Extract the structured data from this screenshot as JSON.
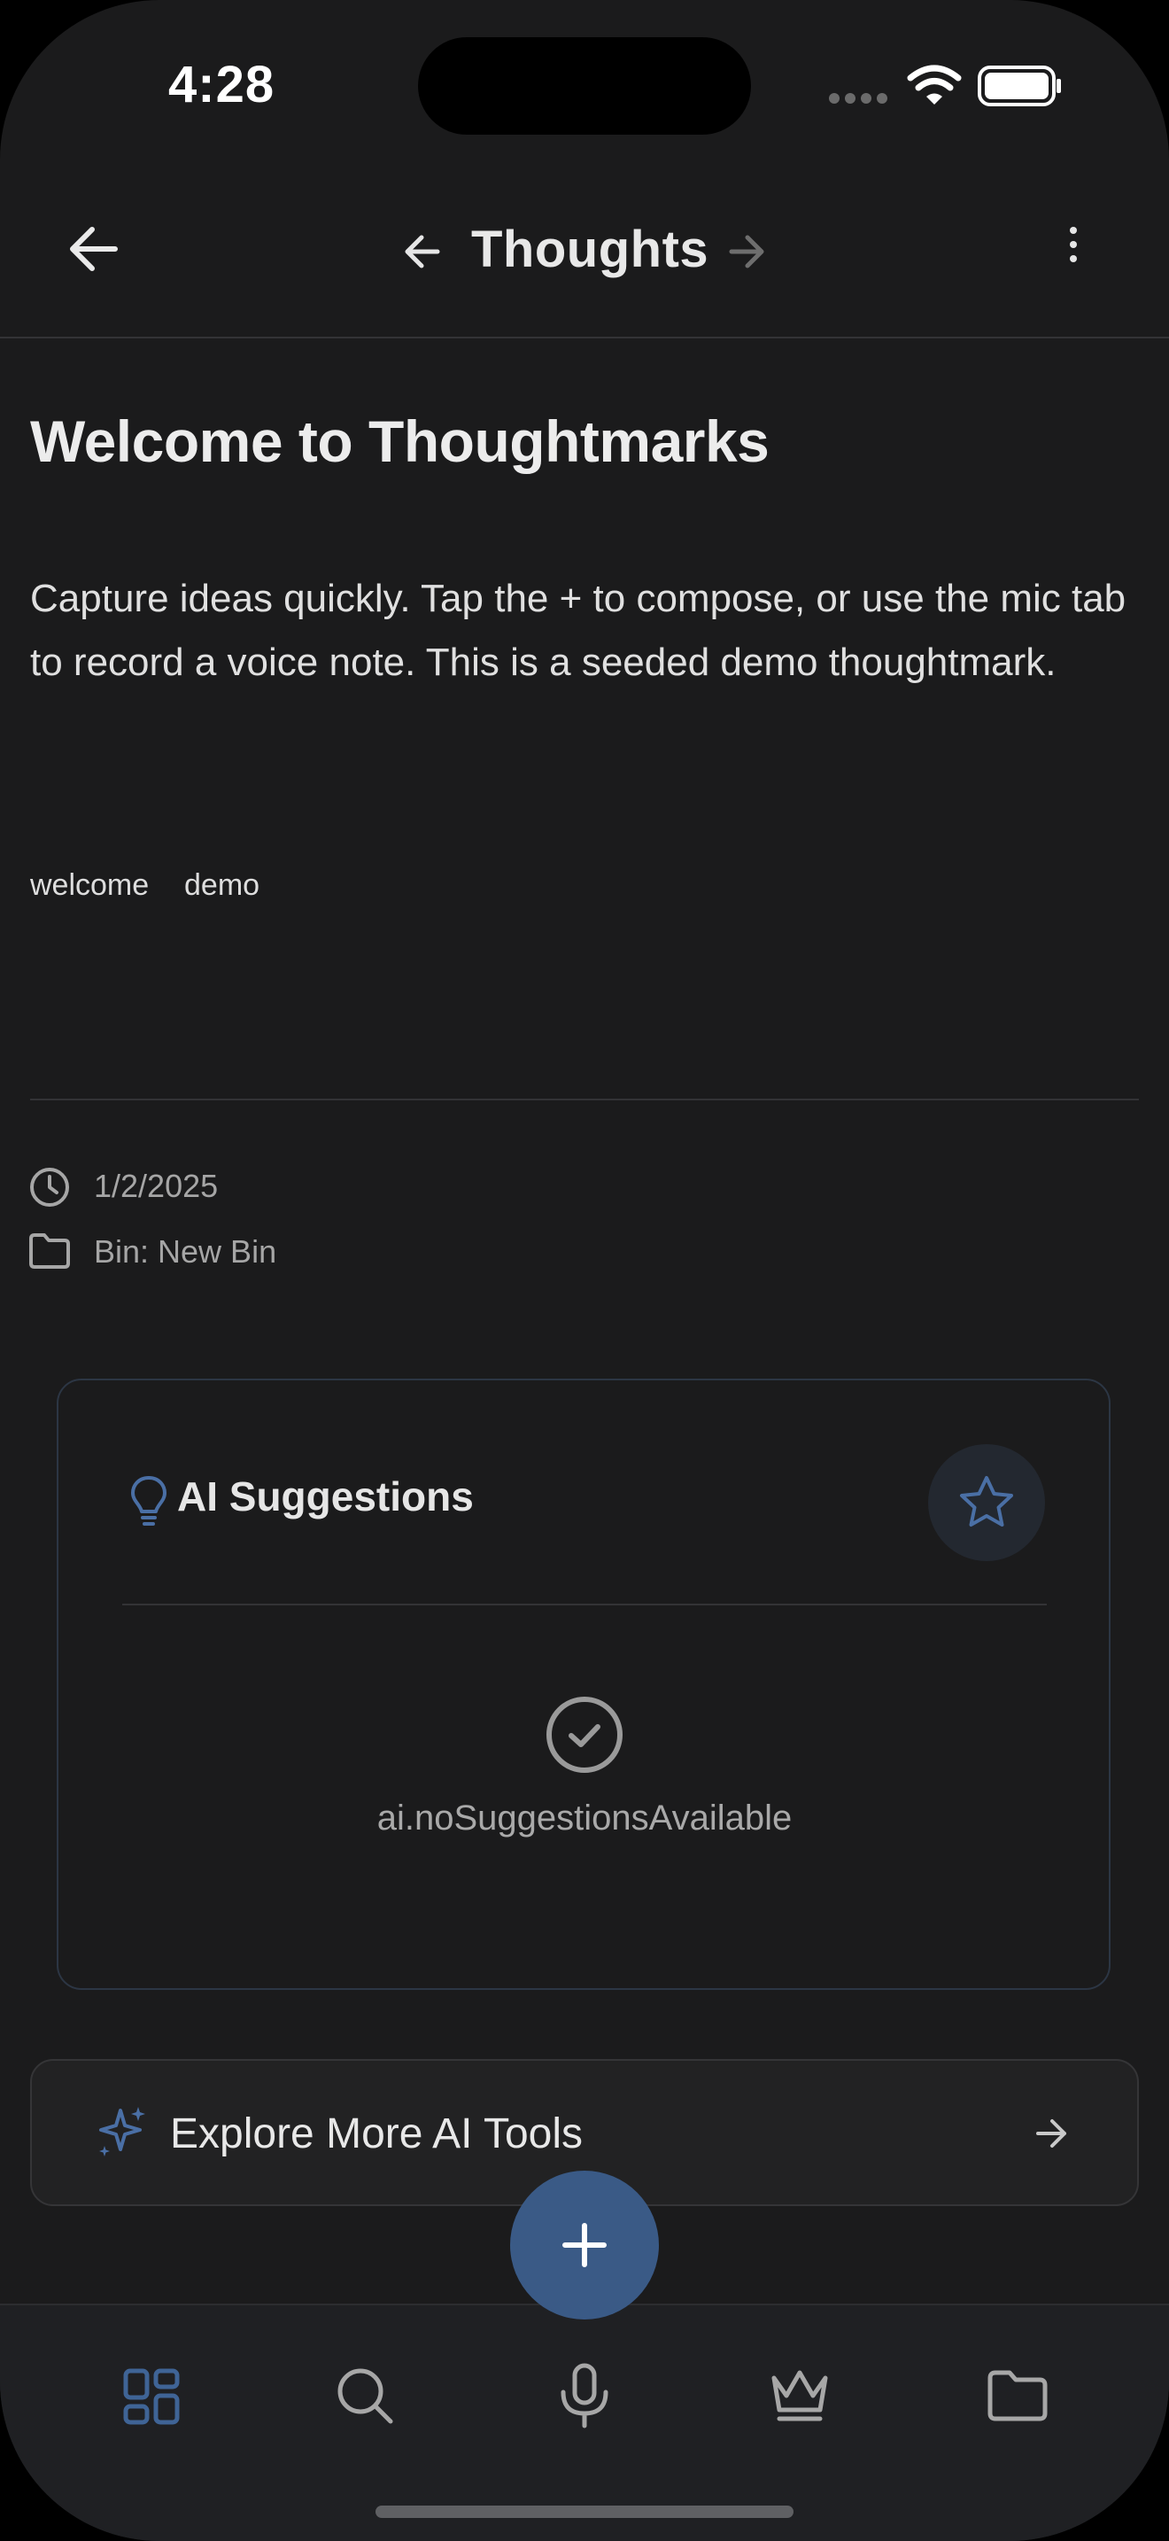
{
  "status_bar": {
    "time": "4:28"
  },
  "nav": {
    "title": "Thoughts"
  },
  "thought": {
    "title": "Welcome to Thoughtmarks",
    "body": "Capture ideas quickly. Tap the + to compose, or use the mic tab to record a voice note. This is a seeded demo thoughtmark.",
    "tags": [
      "welcome",
      "demo"
    ],
    "date": "1/2/2025",
    "bin": "Bin: New Bin"
  },
  "ai_card": {
    "title": "AI Suggestions",
    "empty_text": "ai.noSuggestionsAvailable"
  },
  "explore": {
    "label": "Explore More AI Tools"
  },
  "tabs": [
    {
      "icon": "grid-icon",
      "active": true
    },
    {
      "icon": "search-icon",
      "active": false
    },
    {
      "icon": "mic-icon",
      "active": false
    },
    {
      "icon": "crown-icon",
      "active": false
    },
    {
      "icon": "folder-icon",
      "active": false
    }
  ],
  "colors": {
    "background": "#1b1b1c",
    "accent": "#3a5a86",
    "accent_icon": "#4a6fa5",
    "text_primary": "#ececec",
    "text_secondary": "#a6a6a6"
  }
}
